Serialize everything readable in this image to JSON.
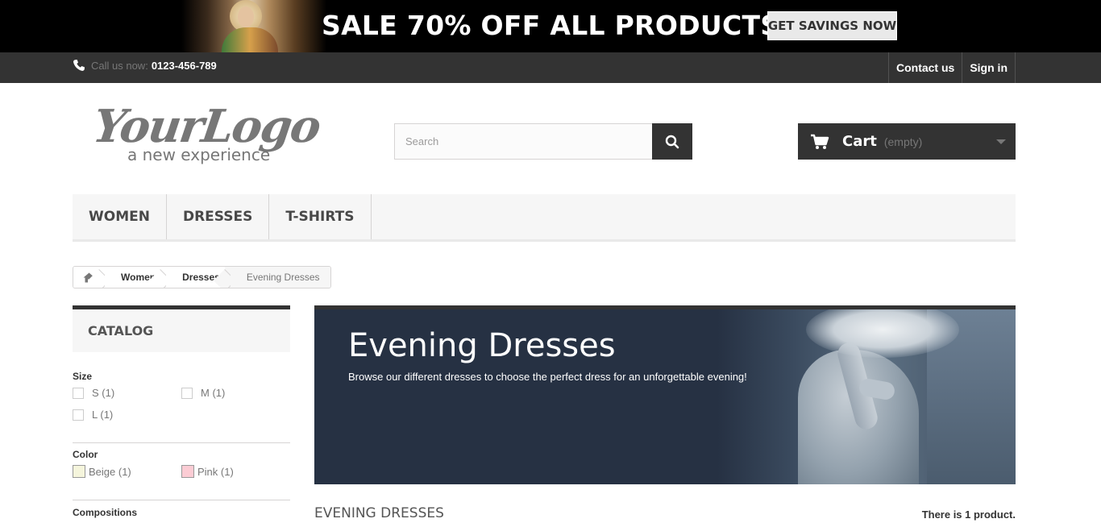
{
  "promo": {
    "headline": "SALE 70% OFF ALL PRODUCTS",
    "button_label": "GET SAVINGS NOW"
  },
  "topbar": {
    "call_label": "Call us now:",
    "phone_number": "0123-456-789",
    "contact_label": "Contact us",
    "signin_label": "Sign in"
  },
  "header": {
    "logo_main": "YourLogo",
    "logo_tagline": "a new experience",
    "search_placeholder": "Search",
    "search_value": "",
    "cart_label": "Cart",
    "cart_status": "(empty)"
  },
  "menu": {
    "items": [
      {
        "label": "Women"
      },
      {
        "label": "Dresses"
      },
      {
        "label": "T-shirts"
      }
    ]
  },
  "breadcrumb": {
    "items": [
      {
        "label": "Women"
      },
      {
        "label": "Dresses"
      },
      {
        "label": "Evening Dresses"
      }
    ]
  },
  "sidebar": {
    "catalog_title": "Catalog",
    "size": {
      "title": "Size",
      "options": [
        {
          "label": "S (1)"
        },
        {
          "label": "M (1)"
        },
        {
          "label": "L (1)"
        }
      ]
    },
    "color": {
      "title": "Color",
      "options": [
        {
          "label": "Beige (1)",
          "swatch": "#f5f5dc"
        },
        {
          "label": "Pink (1)",
          "swatch": "#fcccd4"
        }
      ]
    },
    "compositions": {
      "title": "Compositions"
    }
  },
  "category": {
    "banner_title": "Evening Dresses",
    "banner_description": "Browse our different dresses to choose the perfect dress for an unforgettable evening!",
    "heading": "Evening Dresses",
    "product_count_text": "There is 1 product."
  },
  "colors": {
    "dark": "#333333",
    "banner_bg": "#263143",
    "menu_bg": "#f6f6f6"
  }
}
